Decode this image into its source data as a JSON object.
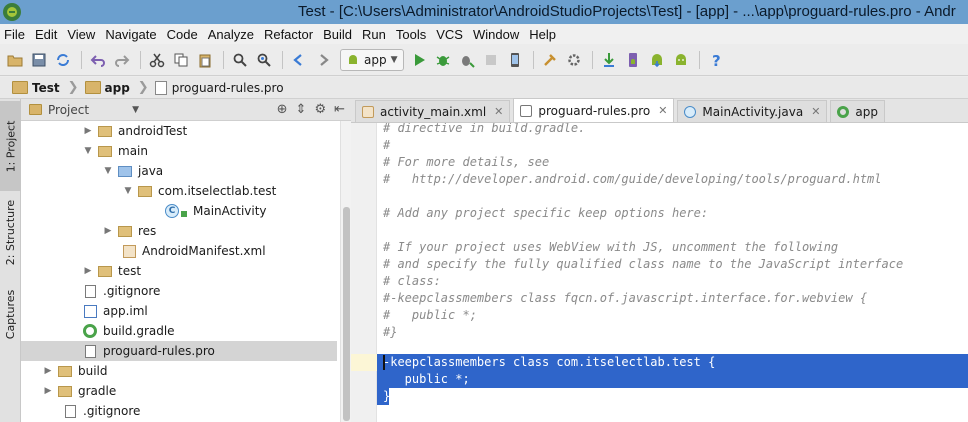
{
  "window": {
    "title": "Test - [C:\\Users\\Administrator\\AndroidStudioProjects\\Test] - [app] - ...\\app\\proguard-rules.pro - Andr"
  },
  "menu": [
    "File",
    "Edit",
    "View",
    "Navigate",
    "Code",
    "Analyze",
    "Refactor",
    "Build",
    "Run",
    "Tools",
    "VCS",
    "Window",
    "Help"
  ],
  "toolbar": {
    "run_config_label": "app"
  },
  "breadcrumb": [
    "Test",
    "app",
    "proguard-rules.pro"
  ],
  "side_tabs": {
    "project": "1: Project",
    "structure": "2: Structure",
    "captures": "Captures"
  },
  "project_panel": {
    "view_selector": "Project",
    "tree": [
      {
        "label": "androidTest",
        "type": "folder",
        "expanded": false
      },
      {
        "label": "main",
        "type": "folder",
        "expanded": true
      },
      {
        "label": "java",
        "type": "java-folder",
        "expanded": true
      },
      {
        "label": "com.itselectlab.test",
        "type": "package",
        "expanded": true
      },
      {
        "label": "MainActivity",
        "type": "class"
      },
      {
        "label": "res",
        "type": "res-folder",
        "expanded": false
      },
      {
        "label": "AndroidManifest.xml",
        "type": "xml"
      },
      {
        "label": "test",
        "type": "folder",
        "expanded": false
      },
      {
        "label": ".gitignore",
        "type": "file"
      },
      {
        "label": "app.iml",
        "type": "iml"
      },
      {
        "label": "build.gradle",
        "type": "gradle"
      },
      {
        "label": "proguard-rules.pro",
        "type": "file",
        "selected": true
      },
      {
        "label": "build",
        "type": "folder",
        "expanded": false
      },
      {
        "label": "gradle",
        "type": "folder",
        "expanded": false
      },
      {
        "label": ".gitignore",
        "type": "file"
      }
    ]
  },
  "editor_tabs": [
    {
      "label": "activity_main.xml",
      "active": false
    },
    {
      "label": "proguard-rules.pro",
      "active": true
    },
    {
      "label": "MainActivity.java",
      "active": false
    },
    {
      "label": "app",
      "active": false
    }
  ],
  "code": {
    "lines": [
      "# directive in build.gradle.",
      "#",
      "# For more details, see",
      "#   http://developer.android.com/guide/developing/tools/proguard.html",
      "",
      "# Add any project specific keep options here:",
      "",
      "# If your project uses WebView with JS, uncomment the following",
      "# and specify the fully qualified class name to the JavaScript interface",
      "# class:",
      "#-keepclassmembers class fqcn.of.javascript.interface.for.webview {",
      "#   public *;",
      "#}",
      "",
      "-keepclassmembers class com.itselectlab.test {",
      "   public *;",
      "}"
    ],
    "selected_from_line": 14,
    "colors": {
      "selection": "#2f65ca",
      "comment": "#8a8a8a"
    }
  }
}
